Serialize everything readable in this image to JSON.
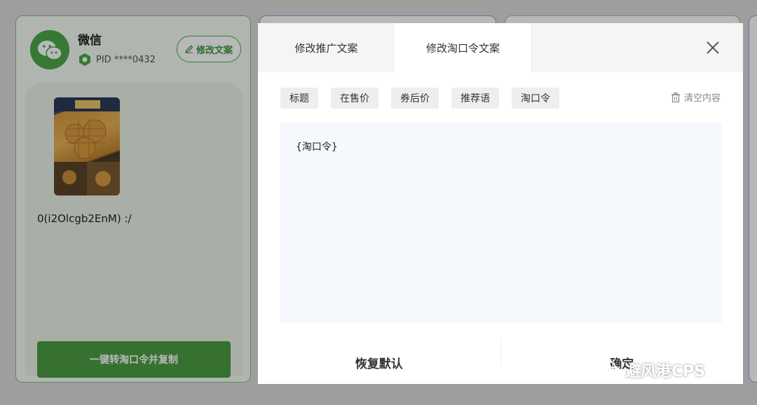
{
  "background": {
    "wechat_card": {
      "name": "微信",
      "pid_label": "PID ****0432",
      "edit_label": "修改文案",
      "preview_text": "0(i2Olcgb2EnM) :/",
      "copy_button_label": "一键转淘口令并复制"
    }
  },
  "modal": {
    "tabs": [
      {
        "label": "修改推广文案"
      },
      {
        "label": "修改淘口令文案"
      }
    ],
    "variable_chips": [
      {
        "label": "标题"
      },
      {
        "label": "在售价"
      },
      {
        "label": "券后价"
      },
      {
        "label": "推荐语"
      },
      {
        "label": "淘口令"
      }
    ],
    "clear_label": "清空内容",
    "editor_content": "{淘口令}",
    "footer": {
      "reset_label": "恢复默认",
      "confirm_label": "确定"
    }
  },
  "watermark": {
    "text": "避风港CPS"
  },
  "colors": {
    "wechat_green": "#4aa84a",
    "copy_button_green": "#4d9d43",
    "editor_background": "#f5f9fd",
    "chip_background": "#eeeeee"
  }
}
